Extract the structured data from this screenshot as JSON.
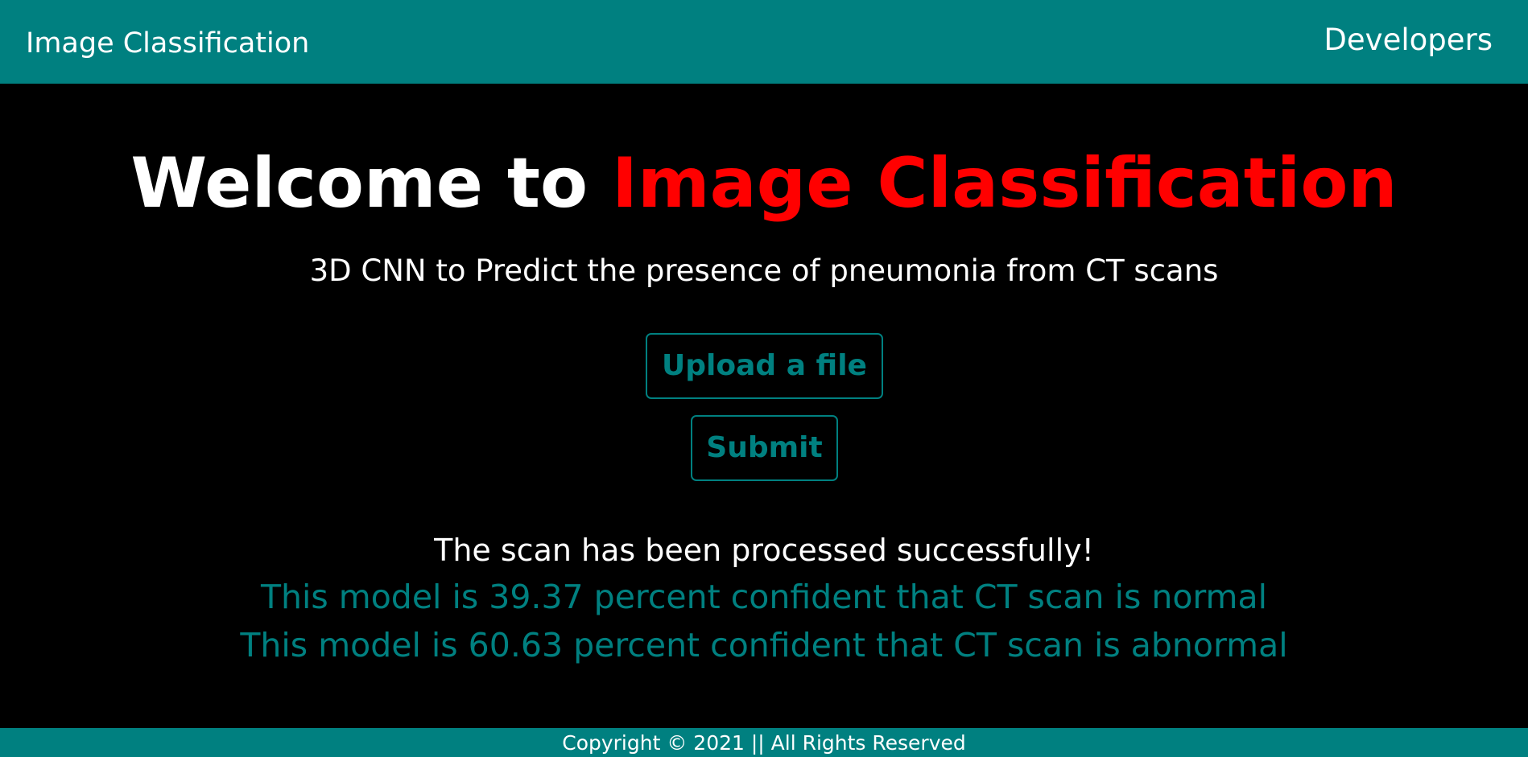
{
  "navbar": {
    "brand": "Image Classification",
    "link": "Developers",
    "bg_color": "#008080"
  },
  "hero": {
    "welcome": "Welcome to",
    "highlight": "Image Classification",
    "highlight_color": "#ff0000"
  },
  "subtitle": "3D CNN to Predict the presence of pneumonia from CT scans",
  "buttons": {
    "upload": "Upload a file",
    "submit": "Submit"
  },
  "results": {
    "status": "The scan has been processed successfully!",
    "normal": "This model is 39.37 percent confident that CT scan is normal",
    "abnormal": "This model is 60.63 percent confident that CT scan is abnormal"
  },
  "footer": {
    "copyright": "Copyright © 2021 || All Rights Reserved"
  },
  "colors": {
    "accent": "#008080",
    "background": "#000000",
    "text": "#ffffff"
  }
}
